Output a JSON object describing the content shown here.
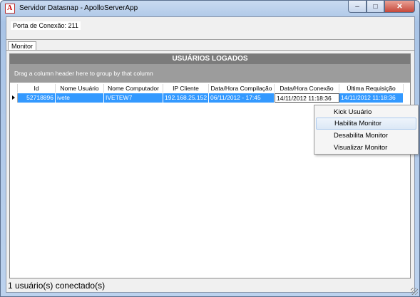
{
  "window": {
    "title": "Servidor Datasnap - ApolloServerApp",
    "buttons": {
      "minimize": "–",
      "maximize": "□",
      "close": "✕"
    }
  },
  "port": {
    "label": "Porta de Conexão: 211"
  },
  "tabs": [
    {
      "label": "Monitor",
      "active": true
    }
  ],
  "grid": {
    "title": "USUÁRIOS LOGADOS",
    "group_hint": "Drag a column header here to group by that column",
    "columns": [
      "Id",
      "Nome Usuário",
      "Nome Computador",
      "IP Cliente",
      "Data/Hora Compilação",
      "Data/Hora Conexão",
      "Última Requisição"
    ],
    "rows": [
      {
        "id": "52718896",
        "usuario": "ivete",
        "computador": "IVETEW7",
        "ip": "192.168.25.152",
        "compilacao": "06/11/2012 - 17:45",
        "conexao": "14/11/2012 11:18:36",
        "requisicao": "14/11/2012 11:18:36"
      }
    ]
  },
  "context_menu": {
    "items": [
      {
        "label": "Kick Usuário"
      },
      {
        "label": "Habilita Monitor"
      },
      {
        "label": "Desabilita Monitor"
      },
      {
        "label": "Visualizar Monitor"
      }
    ],
    "highlighted": "Habilita Monitor"
  },
  "status": {
    "text": "1 usuário(s) conectado(s)"
  },
  "colors": {
    "selection": "#3399ff",
    "grid_header": "#7b7b7b",
    "group_panel": "#9c9c9c"
  }
}
